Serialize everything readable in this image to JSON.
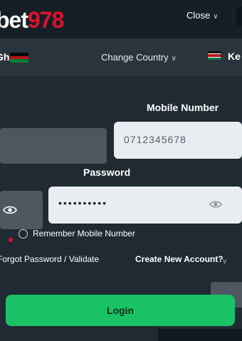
{
  "header": {
    "logo_white": "bet",
    "logo_red": "978",
    "close_label": "Close"
  },
  "country_bar": {
    "country_name": "Ghana",
    "change_country_label": "Change Country",
    "selected_code": "Ke"
  },
  "form": {
    "mobile_label": "Mobile Number",
    "mobile_value": "0712345678",
    "password_label": "Password",
    "password_value": "••••••••••",
    "remember_label": "Remember Mobile Number",
    "forgot_label": "Forgot Password / Validate",
    "create_label": "Create New Account?",
    "login_label": "Login"
  },
  "colors": {
    "brand_red": "#e0102e",
    "login_green": "#19c265",
    "background": "#1f2a33"
  }
}
